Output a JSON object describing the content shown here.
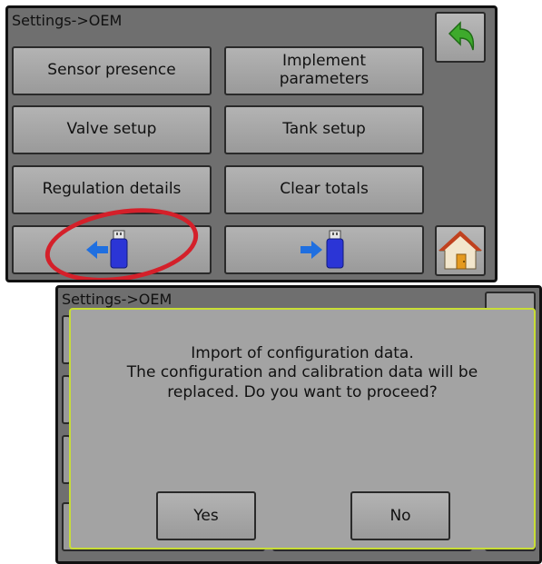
{
  "top_screen": {
    "title": "Settings->OEM",
    "buttons": {
      "sensor_presence": "Sensor presence",
      "implement_parameters_line1": "Implement",
      "implement_parameters_line2": "parameters",
      "valve_setup": "Valve setup",
      "tank_setup": "Tank setup",
      "regulation_details": "Regulation details",
      "clear_totals": "Clear totals"
    },
    "icons": {
      "back": "back-arrow-icon",
      "home": "home-icon",
      "import": "usb-import-icon",
      "export": "usb-export-icon"
    },
    "colors": {
      "highlight": "#d4202a",
      "back_arrow": "#3eaa2c",
      "usb": "#2b35d6",
      "arrow": "#1f6fe0"
    }
  },
  "bottom_screen": {
    "title": "Settings->OEM",
    "dialog": {
      "line1": "Import of configuration data.",
      "line2": "The configuration and calibration data will be",
      "line3": "replaced. Do you want to proceed?",
      "yes_label": "Yes",
      "no_label": "No",
      "border_color": "#c8de35"
    }
  }
}
